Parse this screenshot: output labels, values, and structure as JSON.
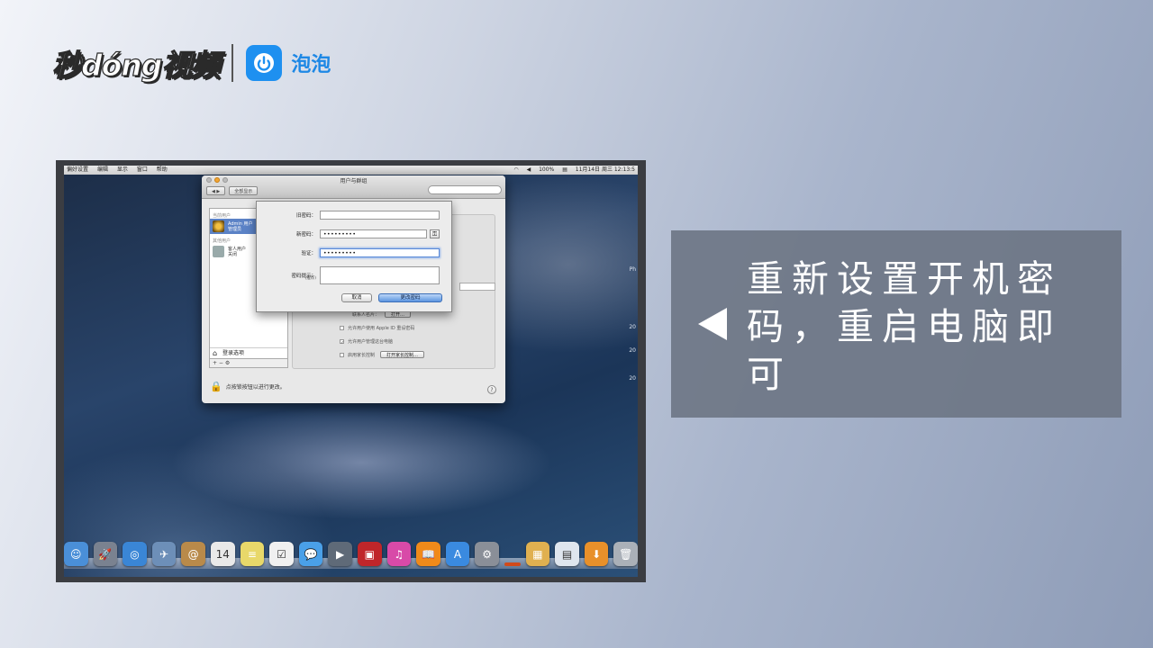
{
  "brand": {
    "logo_text": "秒dóng视频",
    "partner_icon": "power-bubble-icon",
    "partner_name": "泡泡"
  },
  "mac": {
    "menubar": {
      "left_items": [
        "偏好设置",
        "编辑",
        "显示",
        "窗口",
        "帮助"
      ],
      "battery": "100%",
      "date_time": "11月14日 周三  12:13:5"
    },
    "side_numbers": [
      "Ph",
      "20",
      "20",
      "20"
    ],
    "prefs_window": {
      "title": "用户与群组",
      "show_all": "全部显示",
      "list_header_current": "当前用户",
      "current_user_name": "Admin 用户",
      "current_user_role": "管理员",
      "list_header_other": "其他用户",
      "guest_name": "客人用户",
      "guest_status": "关闭",
      "login_options": "登录选项",
      "list_tools": "+ − ⚙",
      "contacts_card_label": "联系人名片：",
      "open_button": "打开…",
      "allow_apple_id": "允许用户使用 Apple ID 重设密码",
      "allow_admin": "允许用户管理这台电脑",
      "parental_controls": "启用家长控制",
      "open_parental_button": "打开家长控制…",
      "lock_text": "点按锁按钮以进行更改。",
      "help": "?"
    },
    "password_sheet": {
      "old_password_label": "旧密码：",
      "old_password_value": "",
      "new_password_label": "新密码：",
      "new_password_value": "•••••••••",
      "verify_label": "验证：",
      "verify_value": "•••••••••",
      "hint_label": "密码提示：",
      "hint_sub": "(推荐)",
      "hint_value": "",
      "key_icon": "⚿",
      "cancel_button": "取消",
      "change_button": "更改密码"
    },
    "dock_icons": [
      {
        "name": "finder-icon",
        "glyph": "☺",
        "color": "#4a8fd8"
      },
      {
        "name": "launchpad-icon",
        "glyph": "🚀",
        "color": "#7a8290"
      },
      {
        "name": "safari-icon",
        "glyph": "◎",
        "color": "#3a86d6"
      },
      {
        "name": "mail-icon",
        "glyph": "✈",
        "color": "#6d8fb8"
      },
      {
        "name": "contacts-icon",
        "glyph": "@",
        "color": "#b98a4a"
      },
      {
        "name": "calendar-icon",
        "glyph": "14",
        "color": "#e9e9e9"
      },
      {
        "name": "notes-icon",
        "glyph": "≡",
        "color": "#e8d86a"
      },
      {
        "name": "reminders-icon",
        "glyph": "☑",
        "color": "#f0f0f0"
      },
      {
        "name": "messages-icon",
        "glyph": "💬",
        "color": "#4aa0e8"
      },
      {
        "name": "facetime-icon",
        "glyph": "▶",
        "color": "#5f6a78"
      },
      {
        "name": "photo-booth-icon",
        "glyph": "▣",
        "color": "#c0262a"
      },
      {
        "name": "itunes-icon",
        "glyph": "♫",
        "color": "#d84aa8"
      },
      {
        "name": "ibooks-icon",
        "glyph": "📖",
        "color": "#f08a1a"
      },
      {
        "name": "app-store-icon",
        "glyph": "A",
        "color": "#3a8ae0"
      },
      {
        "name": "system-preferences-icon",
        "glyph": "⚙",
        "color": "#8a8f98"
      },
      {
        "name": "divider-icon",
        "glyph": "",
        "color": "#d24a1a"
      },
      {
        "name": "applications-folder-icon",
        "glyph": "▦",
        "color": "#e0b050"
      },
      {
        "name": "documents-stack-icon",
        "glyph": "▤",
        "color": "#dfe6ee"
      },
      {
        "name": "downloads-stack-icon",
        "glyph": "⬇",
        "color": "#e8902a"
      },
      {
        "name": "trash-icon",
        "glyph": "🗑",
        "color": "#aab0b8"
      }
    ]
  },
  "caption": {
    "text": "重新设置开机密码，重启电脑即可",
    "arrow_icon": "left-triangle-icon"
  }
}
